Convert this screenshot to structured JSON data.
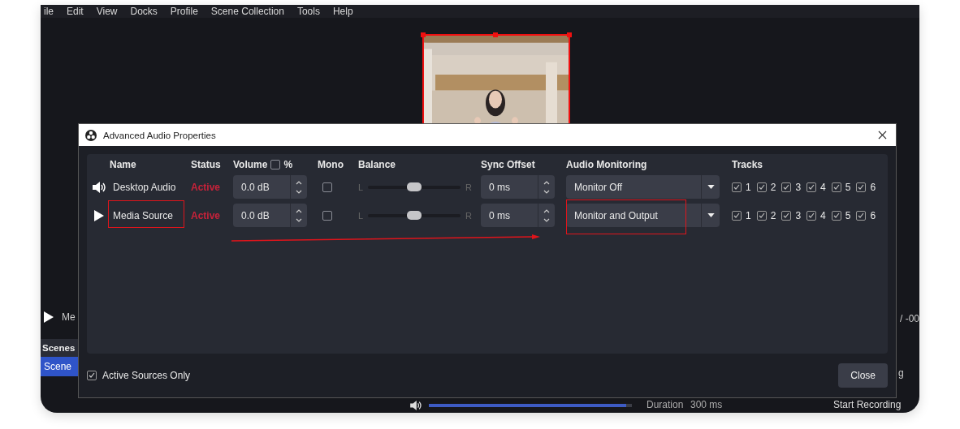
{
  "menu": [
    "ile",
    "Edit",
    "View",
    "Docks",
    "Profile",
    "Scene Collection",
    "Tools",
    "Help"
  ],
  "background": {
    "preview": {
      "kind": "picture",
      "selected": true
    },
    "media_label": "Me",
    "time": "/ -00",
    "scenes_header": "Scenes",
    "scenes": [
      {
        "name": "Scene",
        "selected": true
      }
    ],
    "volume": {
      "level": 0.97
    },
    "duration_label": "Duration",
    "duration_value": "300 ms",
    "side_button": "g",
    "record_button": "Start Recording"
  },
  "dialog": {
    "title": "Advanced Audio Properties",
    "columns": {
      "name": "Name",
      "status": "Status",
      "volume": "Volume",
      "percent": "%",
      "mono": "Mono",
      "balance": "Balance",
      "sync": "Sync Offset",
      "monitoring": "Audio Monitoring",
      "tracks": "Tracks"
    },
    "volume_percent": {
      "checked": false
    },
    "rows": [
      {
        "kind": "speaker",
        "name": "Desktop Audio",
        "status": "Active",
        "volume": "0.0 dB",
        "mono": false,
        "balance": {
          "left": "L",
          "right": "R",
          "level": 0.5
        },
        "sync": "0 ms",
        "monitoring": "Monitor Off",
        "name_highlighted": false,
        "monitoring_highlighted": false,
        "tracks": [
          {
            "label": "1",
            "checked": true
          },
          {
            "label": "2",
            "checked": true
          },
          {
            "label": "3",
            "checked": true
          },
          {
            "label": "4",
            "checked": true
          },
          {
            "label": "5",
            "checked": true
          },
          {
            "label": "6",
            "checked": true
          }
        ]
      },
      {
        "kind": "media",
        "name": "Media Source",
        "status": "Active",
        "volume": "0.0 dB",
        "mono": false,
        "balance": {
          "left": "L",
          "right": "R",
          "level": 0.5
        },
        "sync": "0 ms",
        "monitoring": "Monitor and Output",
        "name_highlighted": true,
        "monitoring_highlighted": true,
        "tracks": [
          {
            "label": "1",
            "checked": true
          },
          {
            "label": "2",
            "checked": true
          },
          {
            "label": "3",
            "checked": true
          },
          {
            "label": "4",
            "checked": true
          },
          {
            "label": "5",
            "checked": true
          },
          {
            "label": "6",
            "checked": true
          }
        ]
      }
    ],
    "arrow": true,
    "active_only": {
      "label": "Active Sources Only",
      "checked": true
    },
    "close_button": "Close"
  }
}
